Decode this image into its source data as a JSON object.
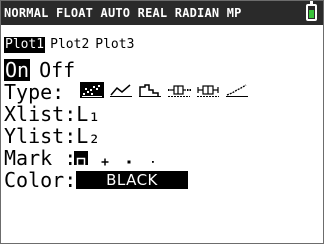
{
  "status_bar": {
    "text": "NORMAL FLOAT AUTO REAL RADIAN MP",
    "battery_color": "#39c23a",
    "battery_level": 0.7
  },
  "plot_tabs": [
    "Plot1",
    "Plot2",
    "Plot3"
  ],
  "selected_plot": 0,
  "on_off": {
    "on_label": "On",
    "off_label": "Off",
    "selected": "On"
  },
  "type": {
    "label": "Type:",
    "icons": [
      "scatter-plot-icon",
      "xy-line-icon",
      "histogram-icon",
      "modified-boxplot-icon",
      "boxplot-icon",
      "normal-probability-icon"
    ],
    "selected_index": 0
  },
  "xlist": {
    "label": "Xlist:",
    "value": "L₁"
  },
  "ylist": {
    "label": "Ylist:",
    "value": "L₂"
  },
  "mark": {
    "label": "Mark :",
    "options": [
      "box-mark-icon",
      "plus-mark-icon",
      "dot-mark-icon",
      "pixel-mark-icon"
    ],
    "selected_index": 0
  },
  "color": {
    "label": "Color:",
    "value": "BLACK"
  }
}
